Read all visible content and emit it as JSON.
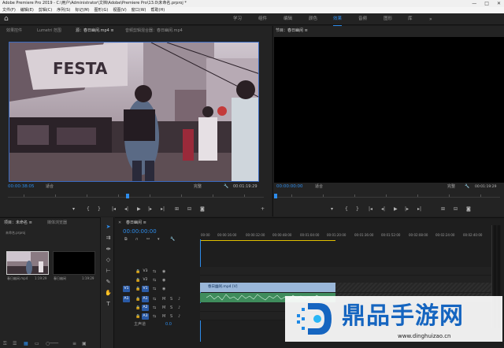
{
  "window": {
    "title": "Adobe Premiere Pro 2019 - C:\\用户\\Administrator\\文档\\Adobe\\Premiere Pro\\13.0\\未命名.prproj *",
    "controls": [
      "—",
      "□",
      "✕"
    ]
  },
  "menu": [
    "文件(F)",
    "编辑(E)",
    "剪辑(C)",
    "序列(S)",
    "标记(M)",
    "图形(G)",
    "视图(V)",
    "窗口(W)",
    "帮助(H)"
  ],
  "workspaces": {
    "items": [
      "学习",
      "组件",
      "编辑",
      "颜色",
      "效果",
      "音频",
      "图形",
      "库"
    ],
    "active": "效果",
    "more": "»"
  },
  "source_monitor": {
    "tabs": [
      "效果控件",
      "Lumetri 范围",
      "源：春日幽闲.mp4 ≡",
      "音频剪辑混合器：春日幽闲.mp4"
    ],
    "timecode_in": "00:00:38:05",
    "fit_label": "适合",
    "quality_label": "完整",
    "duration": "00:01:19:29"
  },
  "program_monitor": {
    "tabs": [
      "节目：春日幽闲 ≡"
    ],
    "timecode": "00:00:00:00",
    "fit_label": "适合",
    "quality_label": "完整",
    "duration": "00:01:19:29"
  },
  "transport": {
    "source": [
      "▾",
      "{",
      "}",
      "|◂",
      "◂|",
      "▶",
      "|▸",
      "▸|",
      "⊞",
      "⊟",
      "◙"
    ],
    "program": [
      "▾",
      "{",
      "}",
      "|◂",
      "◂|",
      "▶",
      "|▸",
      "▸|",
      "⊞",
      "⊟",
      "◙"
    ],
    "add": "+"
  },
  "project": {
    "tabs": [
      "项目：未命名 ≡",
      "媒体浏览器"
    ],
    "path": "未命名.prproj",
    "items": [
      {
        "name": "春日幽闲.mp4",
        "duration": "1:19:29"
      },
      {
        "name": "春日幽闲",
        "duration": "1:19:29"
      }
    ]
  },
  "timeline": {
    "tab": "春日幽闲 ≡",
    "timecode": "00:00:00:00",
    "ruler": [
      "00:00",
      "00:00:16:00",
      "00:00:32:00",
      "00:00:48:00",
      "00:01:04:00",
      "00:01:20:00",
      "00:01:36:00",
      "00:01:52:00",
      "00:02:08:00",
      "00:02:24:00",
      "00:02:40:00"
    ],
    "tracks": [
      {
        "src": "",
        "name": "V3"
      },
      {
        "src": "",
        "name": "V2"
      },
      {
        "src": "V1",
        "name": "V1"
      },
      {
        "src": "A1",
        "name": "A1"
      },
      {
        "src": "",
        "name": "A2"
      },
      {
        "src": "",
        "name": "A3"
      }
    ],
    "master": {
      "label": "主声道",
      "value": "0.0"
    },
    "video_clip": "春日幽闲.mp4 [V]",
    "audio_clip": ""
  },
  "watermark": {
    "text": "鼎品手游网",
    "url": "www.dinghuizao.cn"
  },
  "colors": {
    "accent": "#2d8ceb",
    "video_clip": "#9ab7d9",
    "audio_clip": "#3f8c5c"
  }
}
